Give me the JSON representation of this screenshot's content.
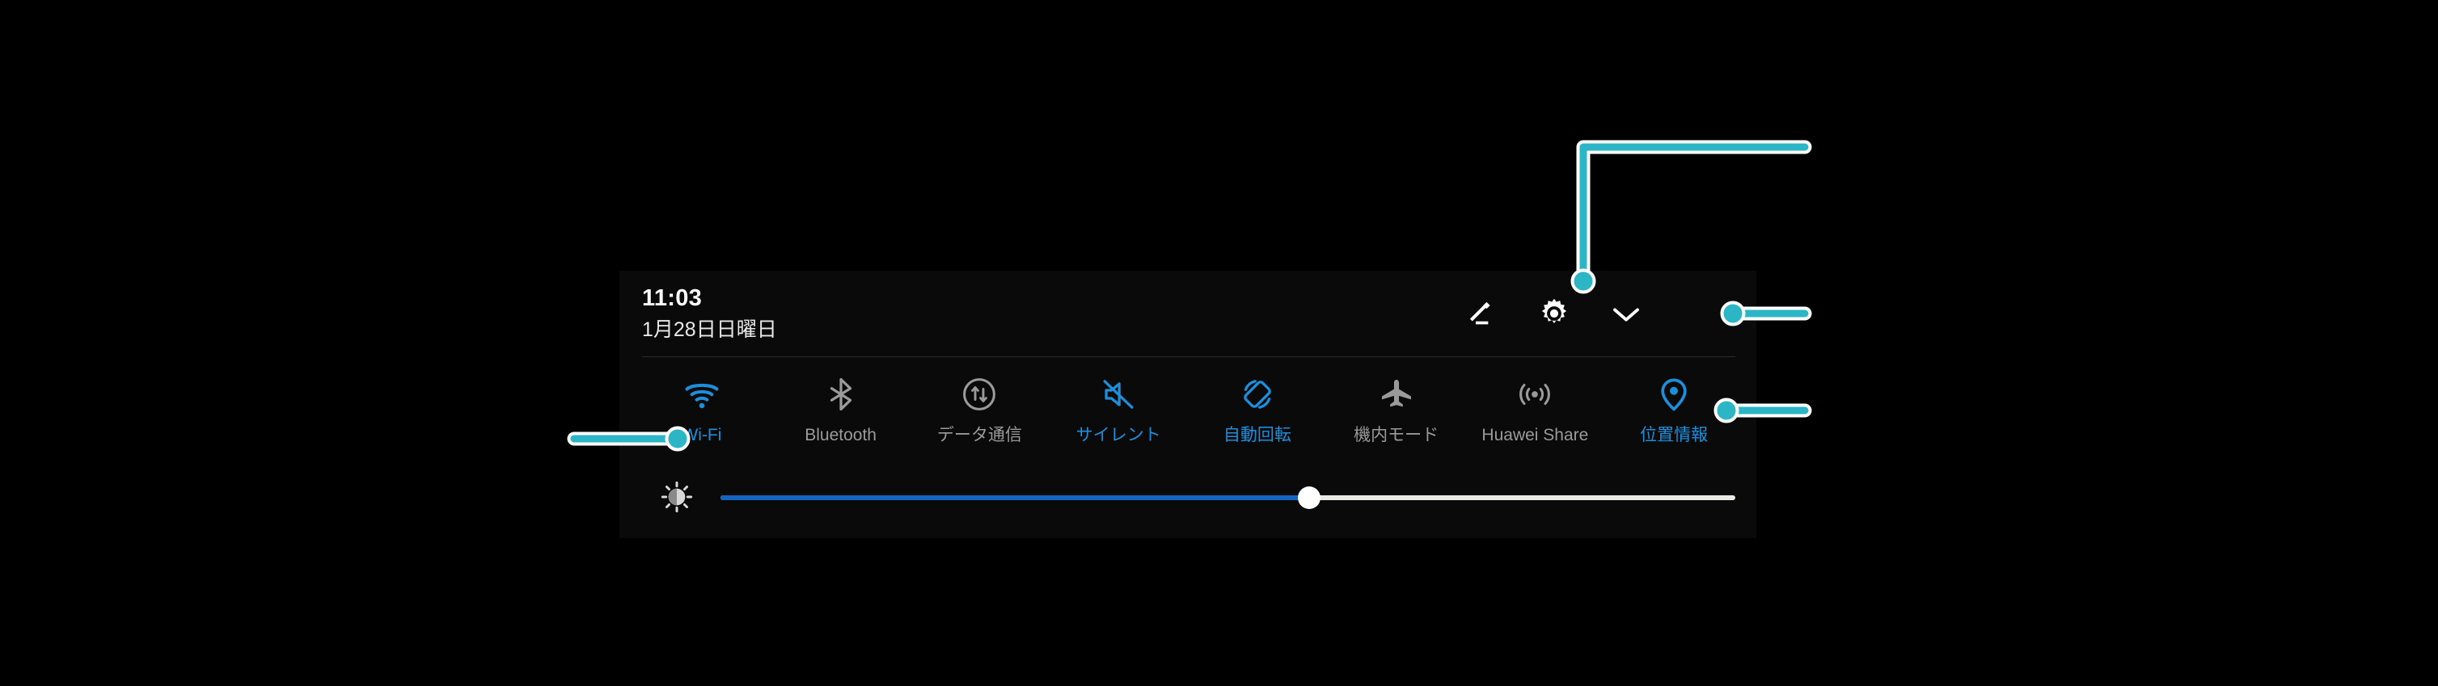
{
  "panel": {
    "name": "android-quick-settings-panel",
    "background_color": "#0b0a0a",
    "screen_background_color": "#000000"
  },
  "header": {
    "time": "11:03",
    "date": "1月28日日曜日",
    "actions": [
      {
        "icon": "edit-pencil-icon",
        "label": "編集"
      },
      {
        "icon": "gear-icon",
        "label": "設定"
      },
      {
        "icon": "chevron-down-icon",
        "label": "展開"
      }
    ]
  },
  "tiles": [
    {
      "label": "Wi-Fi",
      "icon": "wifi-icon",
      "state": "on"
    },
    {
      "label": "Bluetooth",
      "icon": "bluetooth-icon",
      "state": "off"
    },
    {
      "label": "データ通信",
      "icon": "mobile-data-icon",
      "state": "off"
    },
    {
      "label": "サイレント",
      "icon": "mute-icon",
      "state": "on"
    },
    {
      "label": "自動回転",
      "icon": "auto-rotate-icon",
      "state": "on"
    },
    {
      "label": "機内モード",
      "icon": "airplane-icon",
      "state": "off"
    },
    {
      "label": "Huawei Share",
      "icon": "huawei-share-icon",
      "state": "off"
    },
    {
      "label": "位置情報",
      "icon": "location-pin-icon",
      "state": "on"
    }
  ],
  "brightness": {
    "icon": "auto-brightness-icon",
    "value_percent": 58,
    "fill_color": "#1565c0",
    "track_color": "#eceae5"
  },
  "colors": {
    "accent_active": "#1a8fdb",
    "label_inactive": "#9a9a9a",
    "annotation": "#2cb5c4",
    "annotation_outline": "#ffffff"
  },
  "annotations": [
    {
      "name": "callout-wifi",
      "target": "Wi-Fi"
    },
    {
      "name": "callout-edit-pencil",
      "target": "編集"
    },
    {
      "name": "callout-chevron",
      "target": "展開"
    },
    {
      "name": "callout-location",
      "target": "位置情報"
    }
  ]
}
